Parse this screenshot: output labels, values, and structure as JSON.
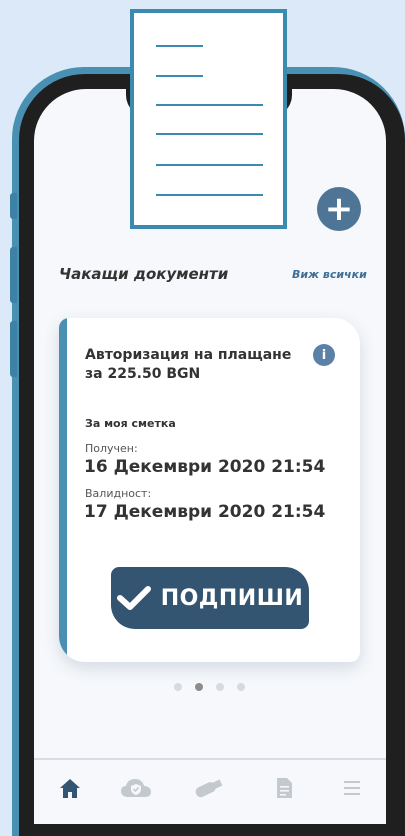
{
  "header": {
    "add_button_label": "+"
  },
  "section": {
    "title": "Чакащи документи",
    "see_all": "Виж всички"
  },
  "card": {
    "title": "Авторизация на плащане за 225.50 BGN",
    "info_icon_glyph": "i",
    "account": "За моя сметка",
    "received_label": "Получен:",
    "received_value": "16 Декември 2020 21:54",
    "validity_label": "Валидност:",
    "validity_value": "17 Декември 2020 21:54",
    "sign_label": "ПОДПИШИ",
    "sign_icon": "check-icon"
  },
  "pagination": {
    "count": 4,
    "active_index": 1
  },
  "nav": {
    "items": [
      {
        "icon": "home-icon",
        "active": true
      },
      {
        "icon": "cloud-shield-icon",
        "active": false
      },
      {
        "icon": "usb-key-icon",
        "active": false
      },
      {
        "icon": "document-icon",
        "active": false
      },
      {
        "icon": "menu-icon",
        "active": false
      }
    ]
  },
  "colors": {
    "accent": "#4a90b2",
    "button": "#335571",
    "background": "#dce9f8",
    "active_nav": "#335571",
    "inactive_nav": "#c4c9ce"
  }
}
